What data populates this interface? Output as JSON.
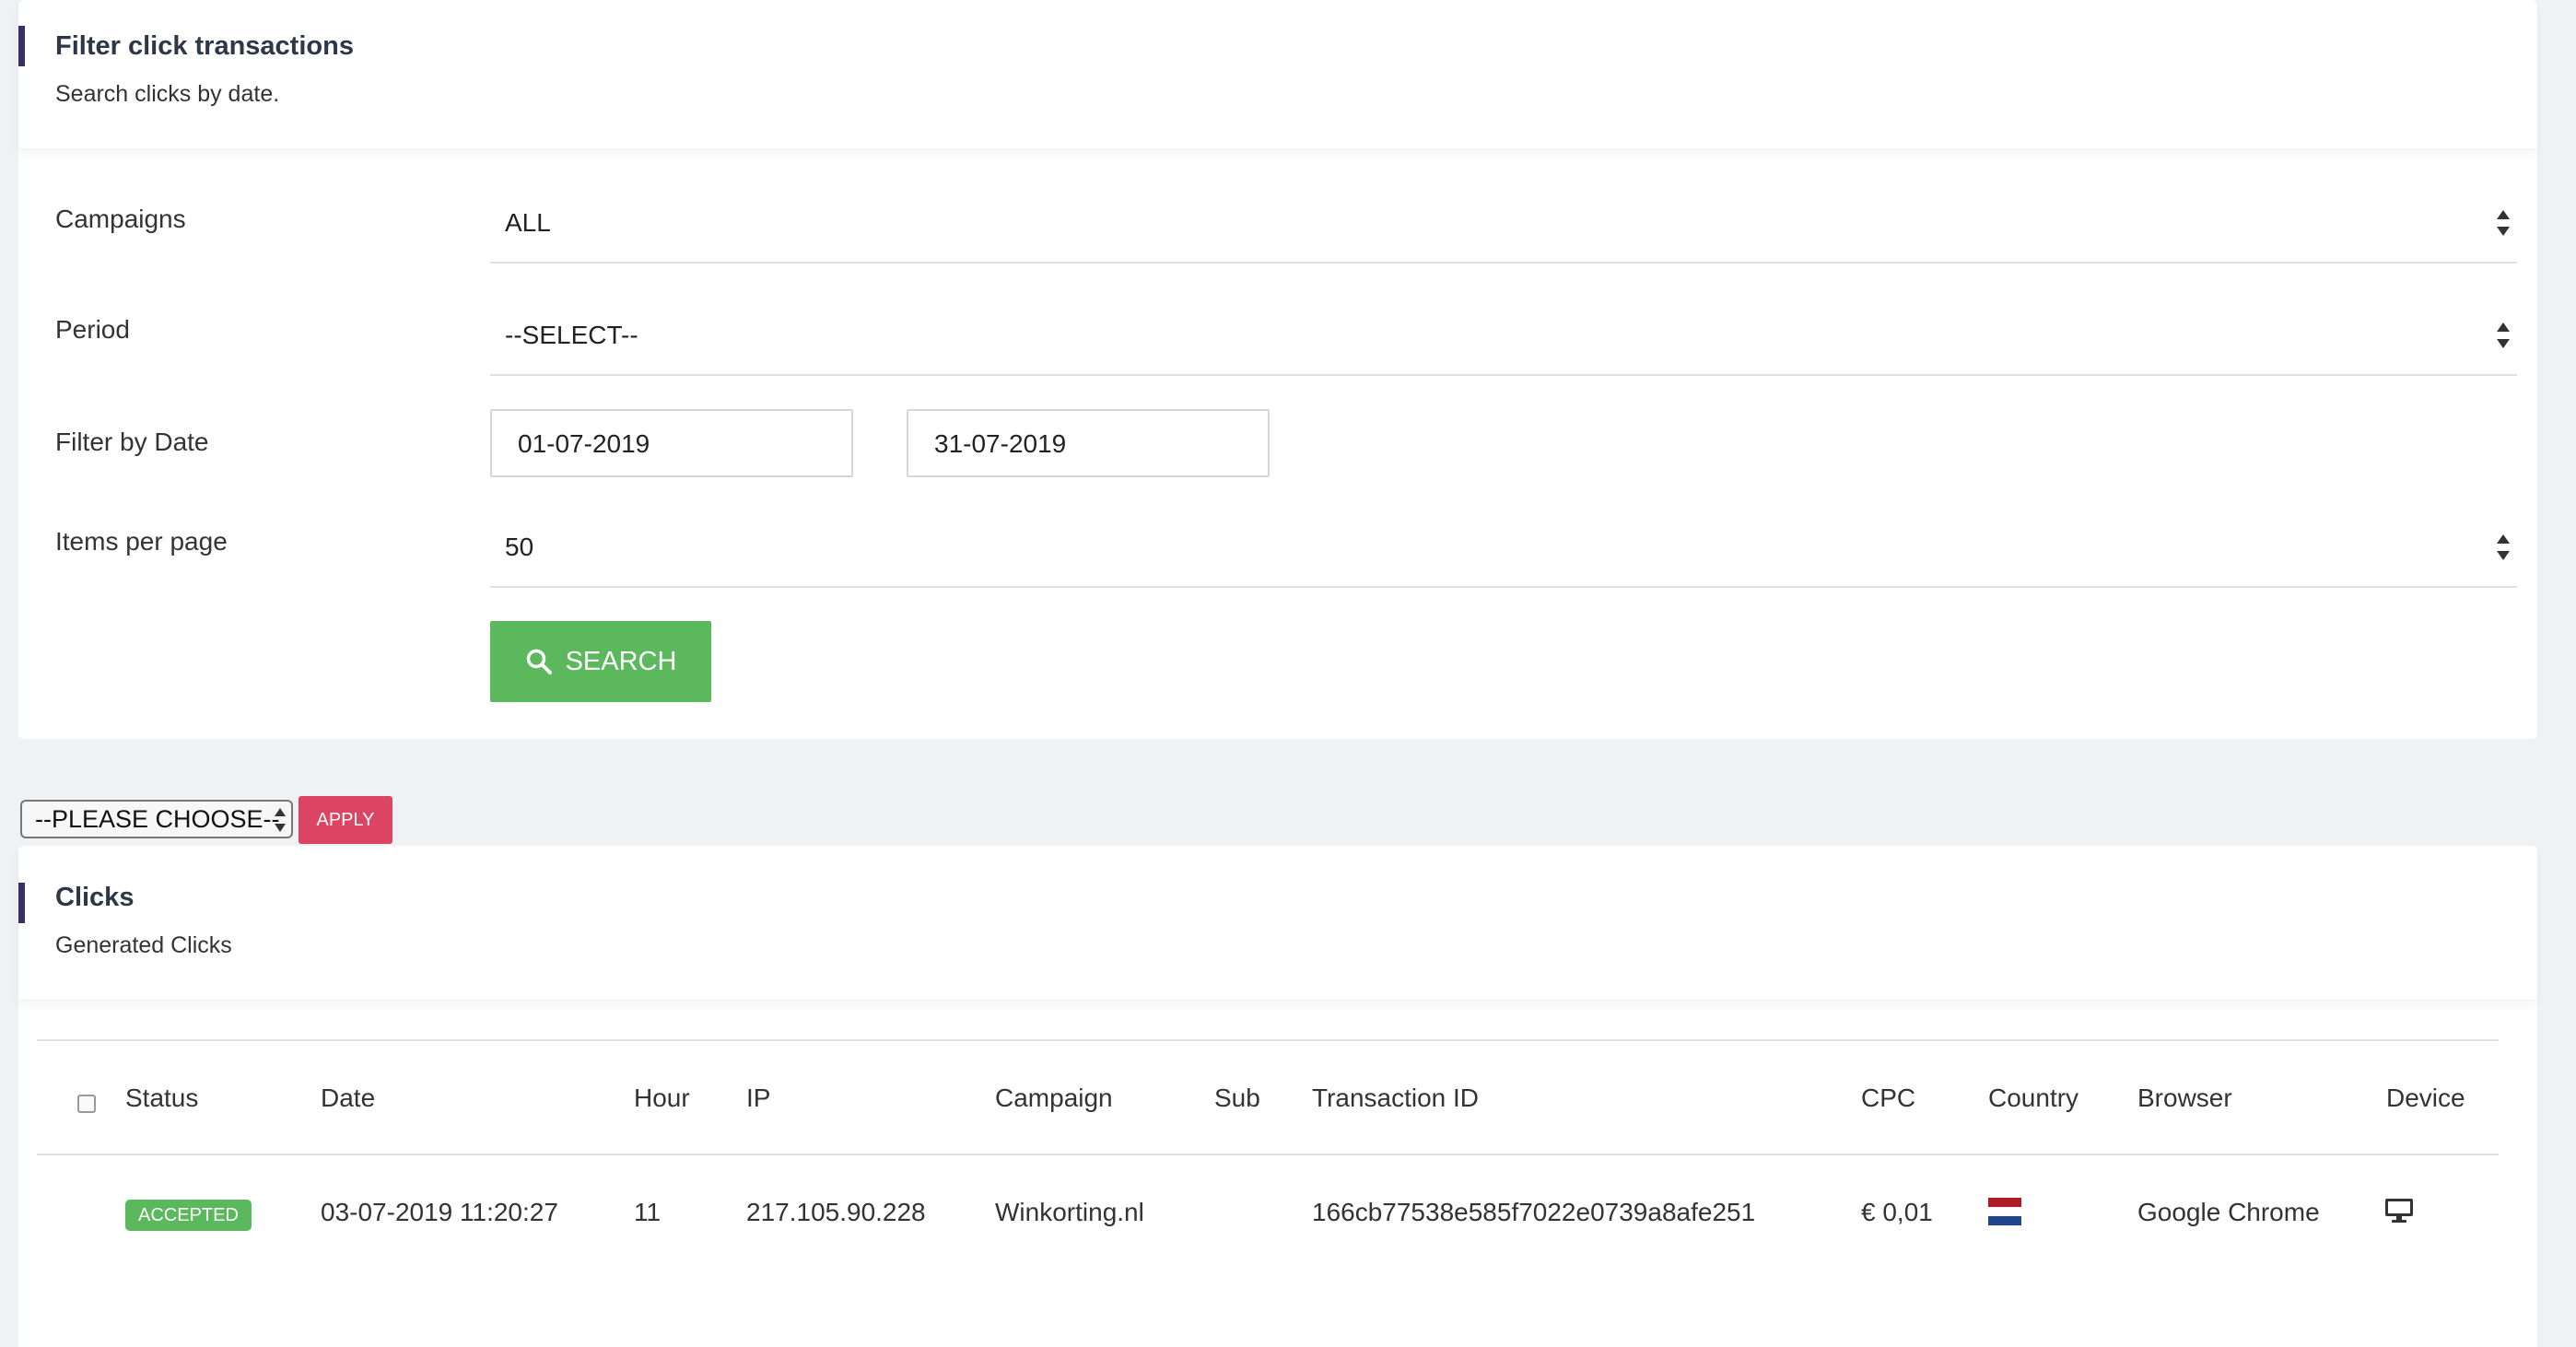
{
  "filter_card": {
    "title": "Filter click transactions",
    "subtitle": "Search clicks by date.",
    "campaigns": {
      "label": "Campaigns",
      "value": "ALL"
    },
    "period": {
      "label": "Period",
      "value": "--SELECT--"
    },
    "filter_by_date": {
      "label": "Filter by Date",
      "from": "01-07-2019",
      "to": "31-07-2019"
    },
    "items_per_page": {
      "label": "Items per page",
      "value": "50"
    },
    "search_button": {
      "label": "SEARCH",
      "icon": "search-icon"
    }
  },
  "bulk_actions": {
    "select_value": "--PLEASE CHOOSE--",
    "apply_label": "APPLY",
    "apply_color": "#dc4463"
  },
  "clicks_card": {
    "title": "Clicks",
    "subtitle": "Generated Clicks",
    "columns": [
      "Status",
      "Date",
      "Hour",
      "IP",
      "Campaign",
      "Sub",
      "Transaction ID",
      "CPC",
      "Country",
      "Browser",
      "Device"
    ],
    "rows": [
      {
        "status": "ACCEPTED",
        "date": "03-07-2019 11:20:27",
        "hour": "11",
        "ip": "217.105.90.228",
        "campaign": "Winkorting.nl",
        "sub": "",
        "transaction_id": "166cb77538e585f7022e0739a8afe251",
        "cpc": "€ 0,01",
        "country_flag": "netherlands-flag-icon",
        "browser": "Google Chrome",
        "device": "desktop-icon"
      }
    ]
  },
  "colors": {
    "accent_bar": "#3b2f63",
    "success": "#5cb85c",
    "danger": "#dc4463",
    "page_bg": "#eef2f5"
  }
}
